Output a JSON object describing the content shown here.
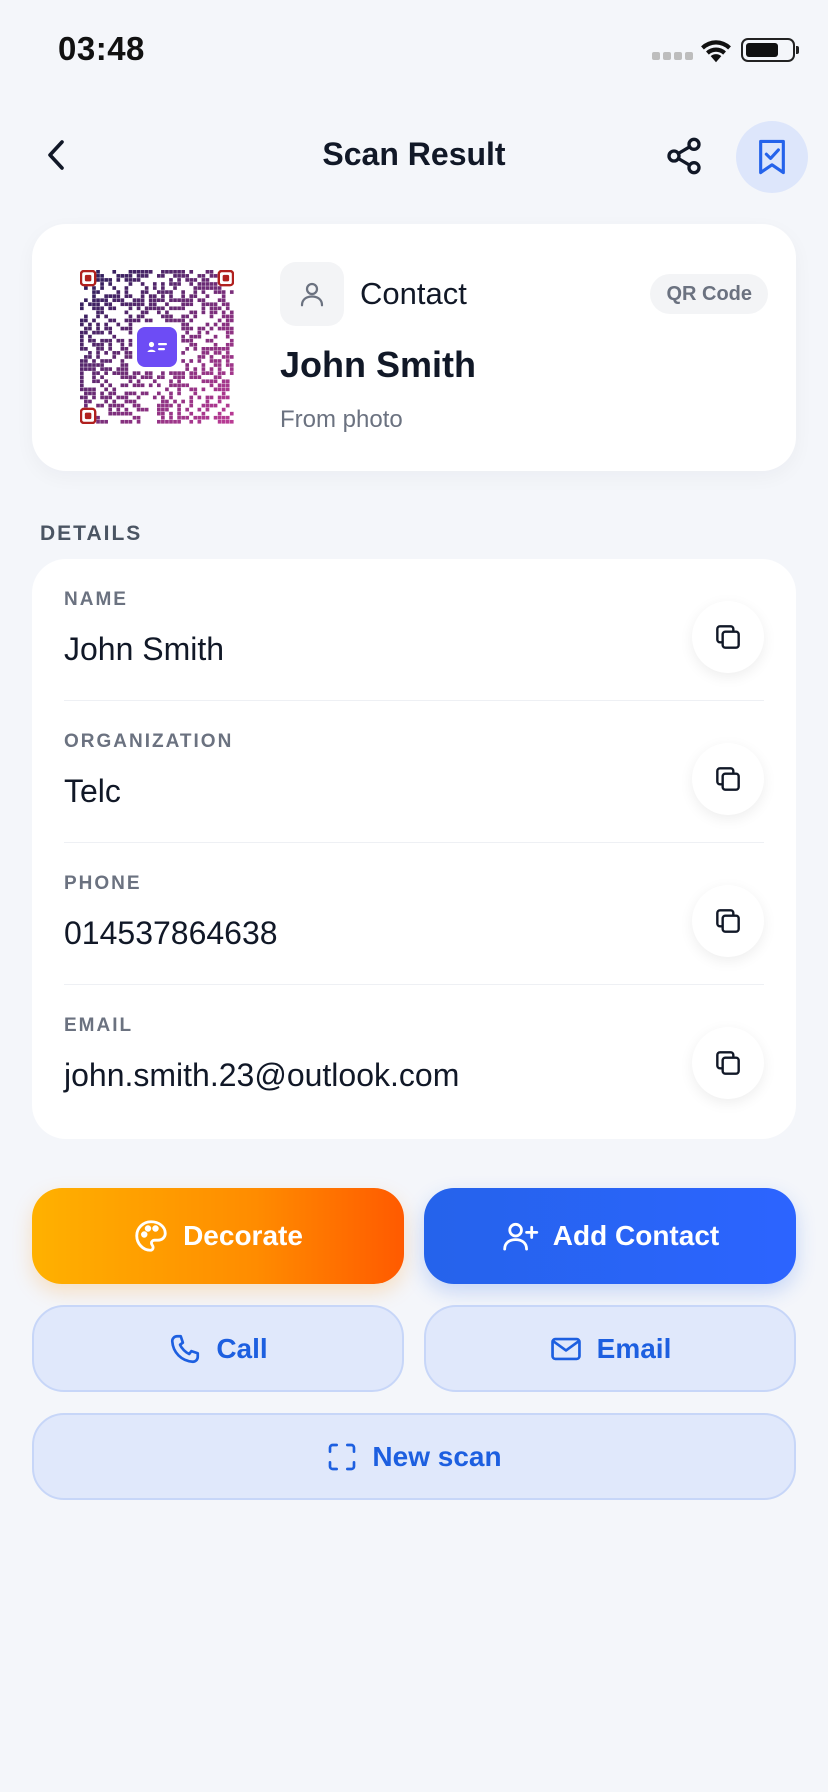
{
  "status_bar": {
    "time": "03:48"
  },
  "nav": {
    "title": "Scan Result"
  },
  "summary": {
    "type_label": "Contact",
    "format": "QR Code",
    "name": "John Smith",
    "source": "From photo"
  },
  "details": {
    "section_label": "DETAILS",
    "fields": [
      {
        "label": "NAME",
        "value": "John Smith"
      },
      {
        "label": "ORGANIZATION",
        "value": "Telc"
      },
      {
        "label": "PHONE",
        "value": "014537864638"
      },
      {
        "label": "EMAIL",
        "value": "john.smith.23@outlook.com"
      }
    ]
  },
  "actions": {
    "decorate": "Decorate",
    "add_contact": "Add Contact",
    "call": "Call",
    "email": "Email",
    "new_scan": "New scan"
  },
  "colors": {
    "accent": "#2563EB",
    "soft_accent": "#E0E8FB",
    "decorate_gradient_start": "#FFB100",
    "decorate_gradient_end": "#FF5A00",
    "qr_center": "#6D4CF5"
  },
  "icons": {
    "back": "chevron-left-icon",
    "share": "share-icon",
    "bookmark": "bookmark-check-icon",
    "type": "person-icon",
    "copy": "copy-icon",
    "decorate": "palette-icon",
    "add_contact": "user-plus-icon",
    "call": "phone-icon",
    "email": "mail-icon",
    "new_scan": "scan-frame-icon"
  }
}
